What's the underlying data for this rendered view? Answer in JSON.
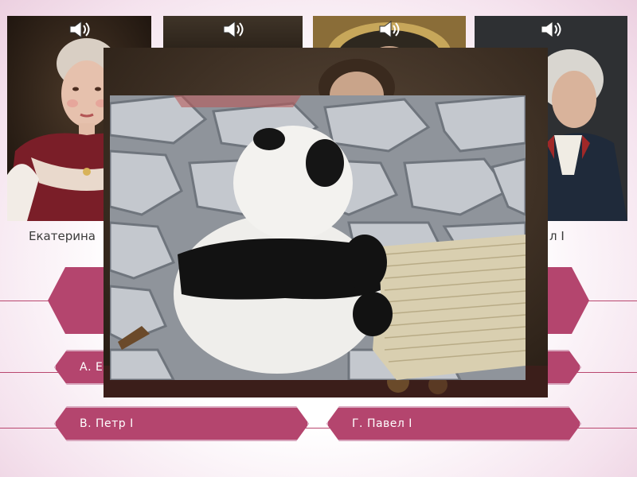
{
  "portraits": [
    {
      "caption": "Екатерина",
      "icon": "speaker-icon"
    },
    {
      "caption": "",
      "icon": "speaker-icon"
    },
    {
      "caption": "",
      "icon": "speaker-icon"
    },
    {
      "caption": "л I",
      "icon": "speaker-icon"
    }
  ],
  "answers": {
    "a": "А. Е",
    "b": "",
    "v": "В. Петр I",
    "g": "Г. Павел I"
  },
  "colors": {
    "accent": "#b4456e",
    "background": "#ffffff",
    "background_edge": "#ecd0e0"
  }
}
